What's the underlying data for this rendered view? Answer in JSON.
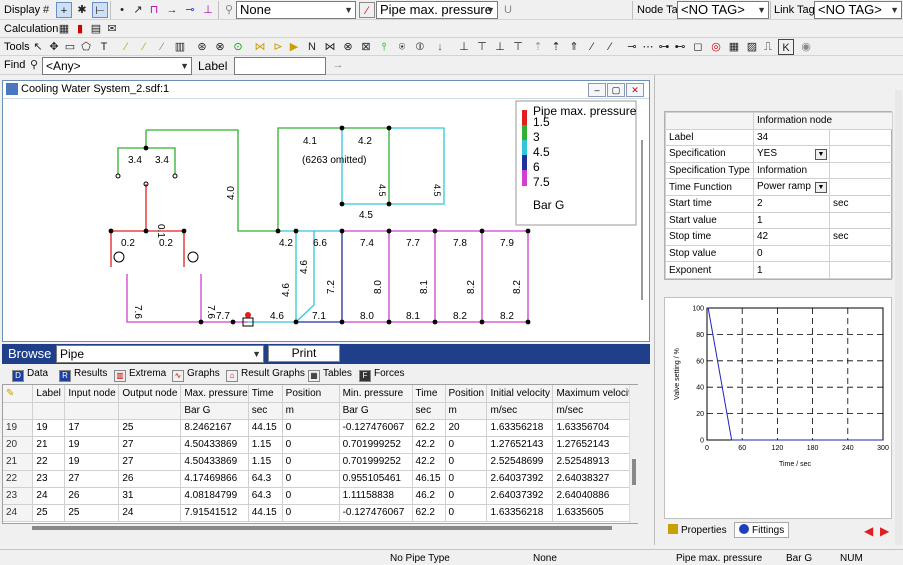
{
  "toolbar1": {
    "display_label": "Display",
    "display_combo": "None",
    "property_combo": "Pipe max. pressure",
    "node_tag_label": "Node Tag",
    "node_tag_value": "<NO TAG>",
    "link_tag_label": "Link Tag",
    "link_tag_value": "<NO TAG>"
  },
  "toolbar2": {
    "calculation_label": "Calculation"
  },
  "toolbar3": {
    "tools_label": "Tools"
  },
  "toolbar4": {
    "find_label": "Find",
    "find_value": "<Any>",
    "label_label": "Label",
    "label_value": ""
  },
  "window": {
    "title": "Cooling Water System_2.sdf:1"
  },
  "legend": {
    "title": "Pipe max. pressure",
    "entries": [
      {
        "label": "1.5",
        "color": "#e02020"
      },
      {
        "label": "3",
        "color": "#30b030"
      },
      {
        "label": "4.5",
        "color": "#30c8d8"
      },
      {
        "label": "6",
        "color": "#2030a0"
      },
      {
        "label": "7.5",
        "color": "#d040d0"
      }
    ],
    "unit": "Bar G"
  },
  "network": {
    "labels": [
      "3.4",
      "3.4",
      "0.1",
      "0.2",
      "0.2",
      "4.0",
      "4.1",
      "4.2",
      "(6263 omitted)",
      "4.5",
      "4.5",
      "4.5",
      "4.2",
      "6.6",
      "7.4",
      "7.7",
      "7.8",
      "7.9",
      "4.6",
      "4.6",
      "7.2",
      "8.0",
      "8.1",
      "8.2",
      "8.2",
      "7.6",
      "7.6",
      "7.7",
      "4.6",
      "7.1",
      "8.0",
      "8.1",
      "8.2",
      "8.2"
    ]
  },
  "browse": {
    "label": "Browse",
    "type_combo": "Pipe",
    "print_label": "Print"
  },
  "result_tabs": [
    "Data",
    "Results",
    "Extrema",
    "Graphs",
    "Result Graphs",
    "Tables",
    "Forces"
  ],
  "grid": {
    "headers": [
      "Label",
      "Input node",
      "Output node",
      "Max. pressure",
      "Time",
      "Position",
      "Min. pressure",
      "Time",
      "Position",
      "Initial velocity",
      "Maximum velocity"
    ],
    "units": [
      "",
      "",
      "",
      "Bar G",
      "sec",
      "m",
      "Bar G",
      "sec",
      "m",
      "m/sec",
      "m/sec"
    ],
    "rows": [
      {
        "row": "19",
        "cells": [
          "19",
          "17",
          "25",
          "8.2462167",
          "44.15",
          "0",
          "-0.127476067",
          "62.2",
          "20",
          "1.63356218",
          "1.63356704"
        ]
      },
      {
        "row": "20",
        "cells": [
          "21",
          "19",
          "27",
          "4.50433869",
          "1.15",
          "0",
          "0.701999252",
          "42.2",
          "0",
          "1.27652143",
          "1.27652143"
        ]
      },
      {
        "row": "21",
        "cells": [
          "22",
          "19",
          "27",
          "4.50433869",
          "1.15",
          "0",
          "0.701999252",
          "42.2",
          "0",
          "2.52548699",
          "2.52548913"
        ]
      },
      {
        "row": "22",
        "cells": [
          "23",
          "27",
          "26",
          "4.17469866",
          "64.3",
          "0",
          "0.955105461",
          "46.15",
          "0",
          "2.64037392",
          "2.64038327"
        ]
      },
      {
        "row": "23",
        "cells": [
          "24",
          "26",
          "31",
          "4.08184799",
          "64.3",
          "0",
          "1.11158838",
          "46.2",
          "0",
          "2.64037392",
          "2.64040886"
        ]
      },
      {
        "row": "24",
        "cells": [
          "25",
          "25",
          "24",
          "7.91541512",
          "44.15",
          "0",
          "-0.127476067",
          "62.2",
          "0",
          "1.63356218",
          "1.6335605"
        ]
      }
    ]
  },
  "properties": {
    "header": "Information node",
    "rows": [
      {
        "name": "Label",
        "value": "34",
        "unit": ""
      },
      {
        "name": "Specification",
        "value": "YES",
        "unit": "",
        "dropdown": true
      },
      {
        "name": "Specification Type",
        "value": "Information",
        "unit": ""
      },
      {
        "name": "Time Function",
        "value": "Power ramp",
        "unit": "",
        "dropdown": true
      },
      {
        "name": "Start time",
        "value": "2",
        "unit": "sec"
      },
      {
        "name": "Start value",
        "value": "1",
        "unit": ""
      },
      {
        "name": "Stop time",
        "value": "42",
        "unit": "sec"
      },
      {
        "name": "Stop value",
        "value": "0",
        "unit": ""
      },
      {
        "name": "Exponent",
        "value": "1",
        "unit": ""
      }
    ]
  },
  "function_chart": {
    "ylabel": "Valve setting / %",
    "xlabel": "Time / sec",
    "yticks": [
      "100",
      "80",
      "60",
      "40",
      "20",
      "0"
    ],
    "xticks": [
      "0",
      "60",
      "120",
      "180",
      "240",
      "300"
    ],
    "line_color": "#2020c0"
  },
  "chart_data": {
    "type": "line",
    "x": [
      0,
      2,
      42,
      300
    ],
    "y": [
      100,
      100,
      0,
      0
    ],
    "xlabel": "Time / sec",
    "ylabel": "Valve setting / %",
    "xlim": [
      0,
      300
    ],
    "ylim": [
      0,
      100
    ],
    "grid": true
  },
  "bottom_tabs": {
    "properties": "Properties",
    "fittings": "Fittings"
  },
  "status": {
    "pipe_type": "No Pipe Type",
    "none": "None",
    "property": "Pipe max. pressure",
    "unit": "Bar G",
    "num": "NUM"
  }
}
